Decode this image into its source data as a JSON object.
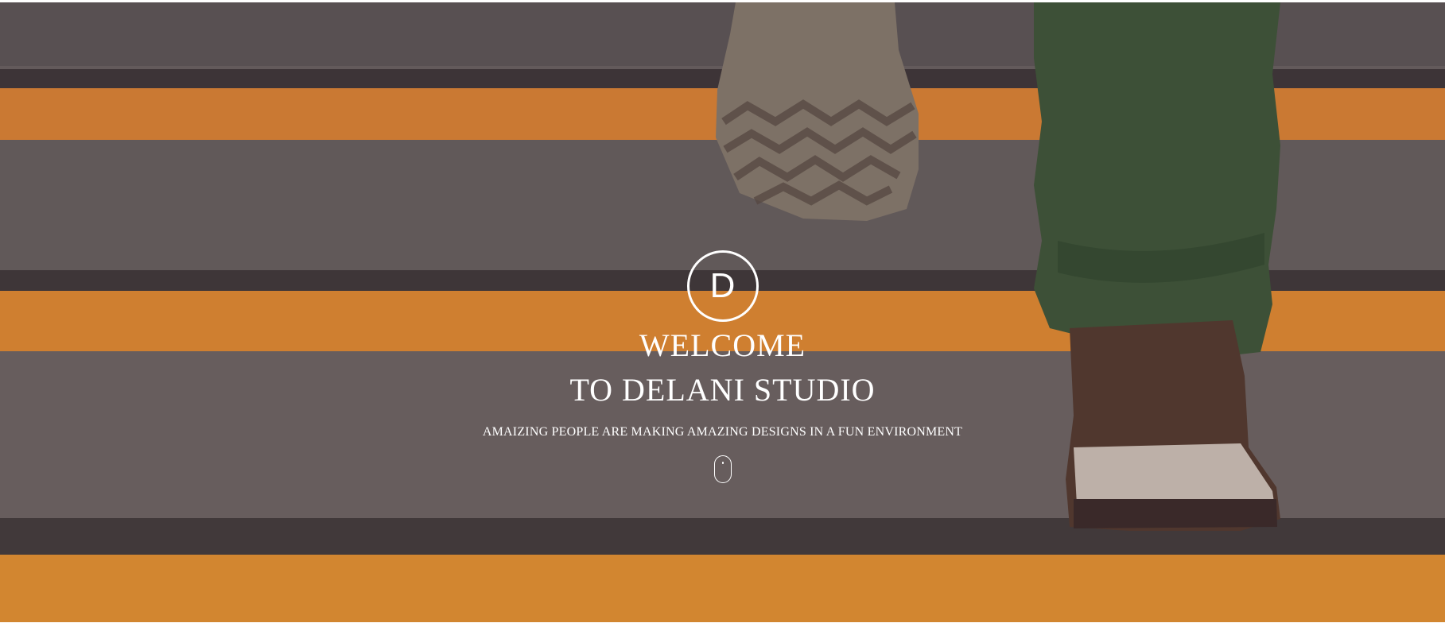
{
  "hero": {
    "logo_letter": "D",
    "title_line1": "WELCOME",
    "title_line2": "TO DELANI STUDIO",
    "tagline": "AMAIZING PEOPLE ARE MAKING AMAZING DESIGNS IN A FUN ENVIRONMENT",
    "scroll_indicator_icon": "mouse-scroll-icon",
    "background_image_icon": "stairs-photo",
    "colors": {
      "text": "#ffffff",
      "stripe_orange": "#f0962e",
      "step_gray": "#6e6864",
      "edge_dark": "#3f3a3a",
      "pants_green": "#3a5a36"
    }
  }
}
